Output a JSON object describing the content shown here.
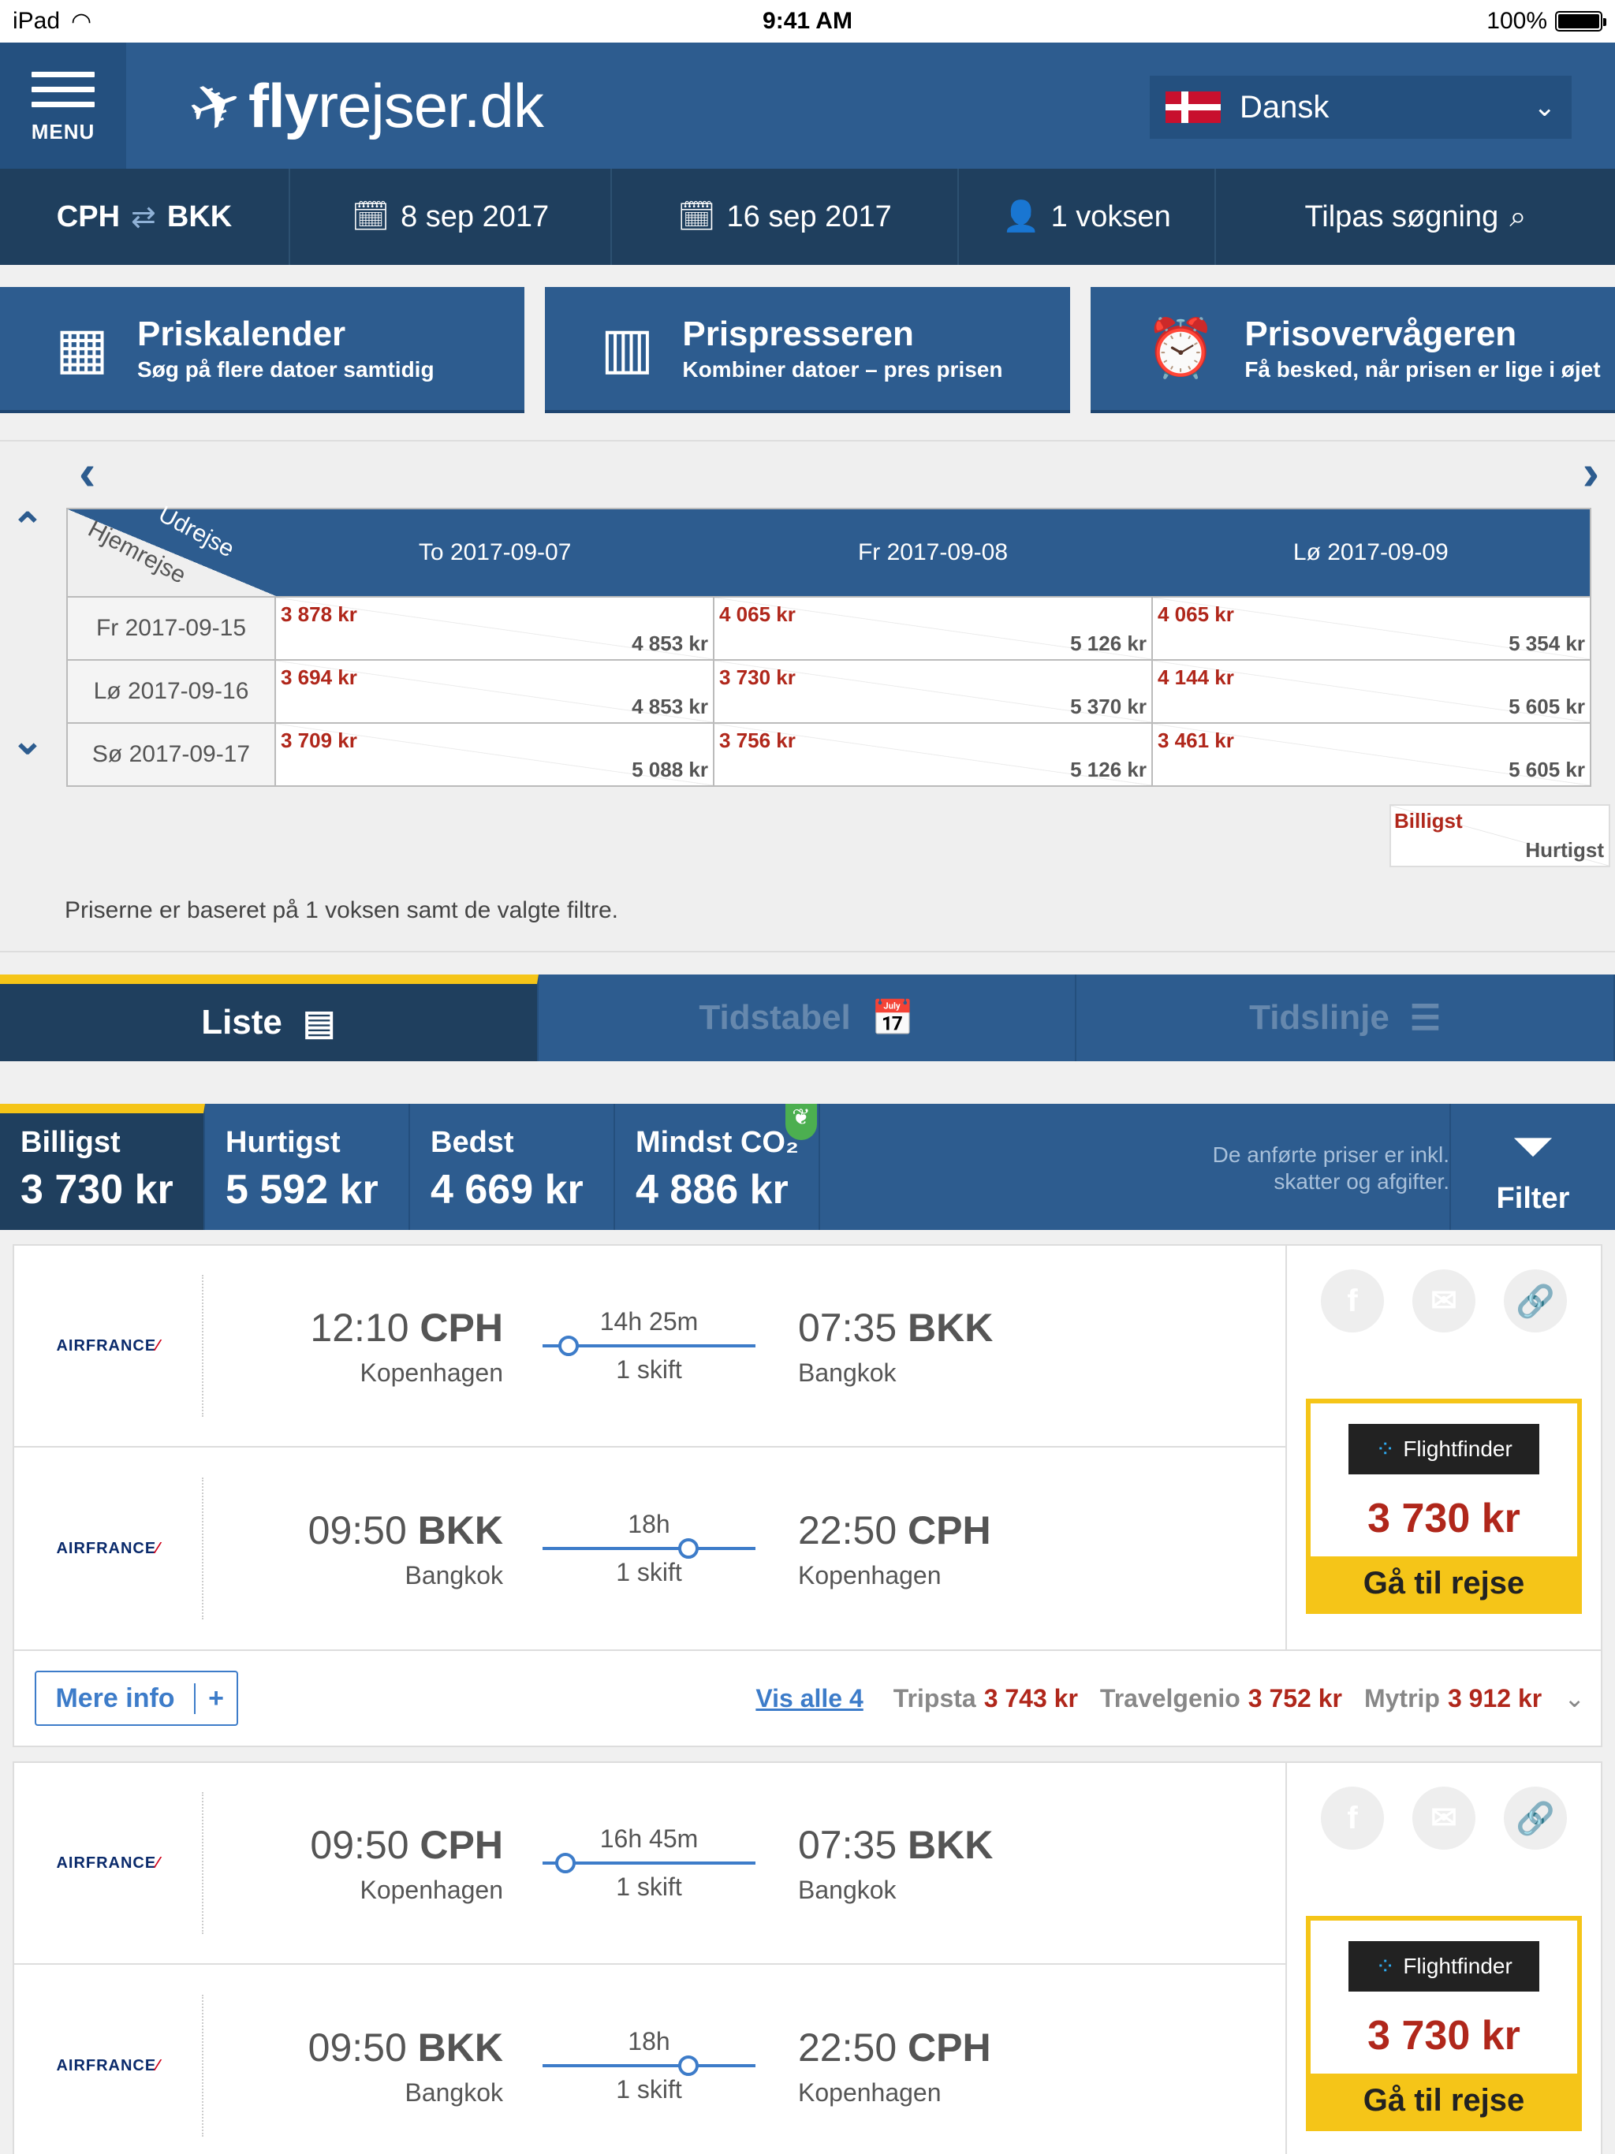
{
  "status": {
    "device": "iPad",
    "time": "9:41 AM",
    "battery": "100%"
  },
  "header": {
    "menu_label": "MENU",
    "logo_bold": "fly",
    "logo_rest": "rejser.dk",
    "language": "Dansk"
  },
  "search": {
    "from": "CPH",
    "to": "BKK",
    "depart": "8 sep 2017",
    "return": "16 sep 2017",
    "passengers": "1 voksen",
    "adjust": "Tilpas søgning"
  },
  "tools": [
    {
      "title": "Priskalender",
      "subtitle": "Søg på flere datoer samtidig"
    },
    {
      "title": "Prispresseren",
      "subtitle": "Kombiner datoer – pres prisen"
    },
    {
      "title": "Prisovervågeren",
      "subtitle": "Få besked, når prisen er lige i øjet"
    }
  ],
  "calendar": {
    "corner_out": "Udrejse",
    "corner_home": "Hjemrejse",
    "columns": [
      "To 2017-09-07",
      "Fr 2017-09-08",
      "Lø 2017-09-09"
    ],
    "rows": [
      {
        "label": "Fr 2017-09-15",
        "cells": [
          {
            "cheap": "3 878 kr",
            "fast": "4 853 kr"
          },
          {
            "cheap": "4 065 kr",
            "fast": "5 126 kr"
          },
          {
            "cheap": "4 065 kr",
            "fast": "5 354 kr"
          }
        ]
      },
      {
        "label": "Lø 2017-09-16",
        "cells": [
          {
            "cheap": "3 694 kr",
            "fast": "4 853 kr"
          },
          {
            "cheap": "3 730 kr",
            "fast": "5 370 kr"
          },
          {
            "cheap": "4 144 kr",
            "fast": "5 605 kr"
          }
        ]
      },
      {
        "label": "Sø 2017-09-17",
        "cells": [
          {
            "cheap": "3 709 kr",
            "fast": "5 088 kr"
          },
          {
            "cheap": "3 756 kr",
            "fast": "5 126 kr"
          },
          {
            "cheap": "3 461 kr",
            "fast": "5 605 kr"
          }
        ]
      }
    ],
    "legend_cheap": "Billigst",
    "legend_fast": "Hurtigst",
    "note": "Priserne er baseret på 1 voksen samt de valgte filtre."
  },
  "view_tabs": [
    "Liste",
    "Tidstabel",
    "Tidslinje"
  ],
  "sort": [
    {
      "label": "Billigst",
      "value": "3 730 kr"
    },
    {
      "label": "Hurtigst",
      "value": "5 592 kr"
    },
    {
      "label": "Bedst",
      "value": "4 669 kr"
    },
    {
      "label": "Mindst CO₂",
      "value": "4 886 kr"
    }
  ],
  "sort_note": "De anførte priser er inkl. skatter og afgifter.",
  "filter_label": "Filter",
  "results": [
    {
      "legs": [
        {
          "airline": "AIRFRANCE",
          "dep_time": "12:10",
          "dep_code": "CPH",
          "dep_city": "Kopenhagen",
          "duration": "14h 25m",
          "stops": "1 skift",
          "arr_time": "07:35",
          "arr_code": "BKK",
          "arr_city": "Bangkok"
        },
        {
          "airline": "AIRFRANCE",
          "dep_time": "09:50",
          "dep_code": "BKK",
          "dep_city": "Bangkok",
          "duration": "18h",
          "stops": "1 skift",
          "arr_time": "22:50",
          "arr_code": "CPH",
          "arr_city": "Kopenhagen"
        }
      ],
      "provider": "Flightfinder",
      "price": "3 730 kr",
      "cta": "Gå til rejse",
      "more_info": "Mere info",
      "see_all": "Vis alle 4",
      "others": [
        {
          "name": "Tripsta",
          "price": "3 743 kr"
        },
        {
          "name": "Travelgenio",
          "price": "3 752 kr"
        },
        {
          "name": "Mytrip",
          "price": "3 912 kr"
        }
      ]
    },
    {
      "legs": [
        {
          "airline": "AIRFRANCE",
          "dep_time": "09:50",
          "dep_code": "CPH",
          "dep_city": "Kopenhagen",
          "duration": "16h 45m",
          "stops": "1 skift",
          "arr_time": "07:35",
          "arr_code": "BKK",
          "arr_city": "Bangkok"
        },
        {
          "airline": "AIRFRANCE",
          "dep_time": "09:50",
          "dep_code": "BKK",
          "dep_city": "Bangkok",
          "duration": "18h",
          "stops": "1 skift",
          "arr_time": "22:50",
          "arr_code": "CPH",
          "arr_city": "Kopenhagen"
        }
      ],
      "provider": "Flightfinder",
      "price": "3 730 kr",
      "cta": "Gå til rejse"
    }
  ]
}
